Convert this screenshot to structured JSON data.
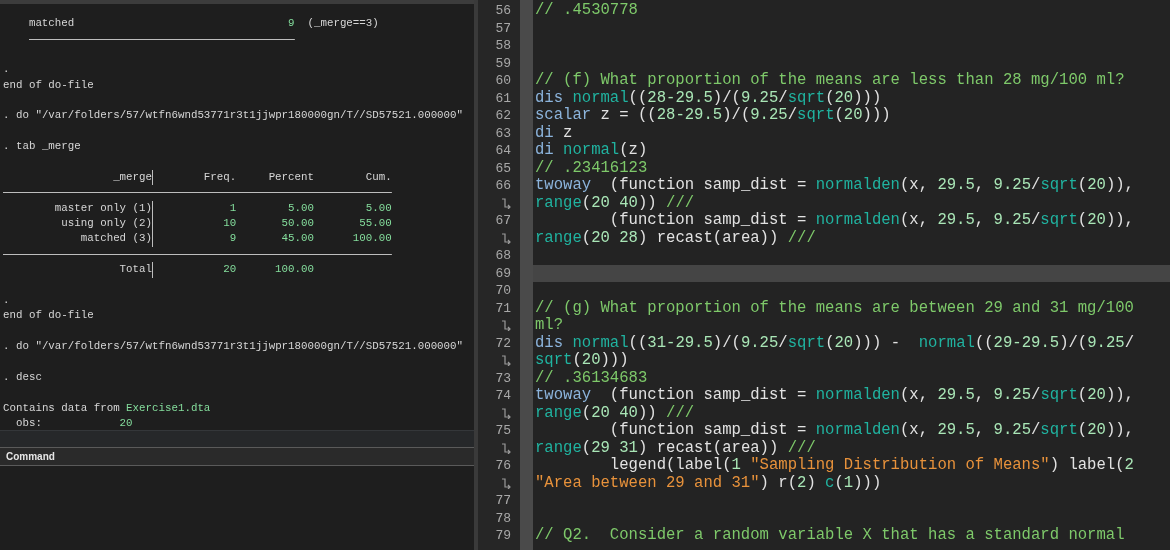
{
  "results": {
    "items": [
      {
        "kind": "summary",
        "label": "matched",
        "value": "9",
        "note": "(_merge==3)"
      },
      {
        "kind": "spacer"
      },
      {
        "kind": "text",
        "text": "."
      },
      {
        "kind": "text",
        "text": "end of do-file"
      },
      {
        "kind": "spacer"
      },
      {
        "kind": "text",
        "text": ". do \"/var/folders/57/wtfn6wnd53771r3t1jjwpr180000gn/T//SD57521.000000\""
      },
      {
        "kind": "spacer"
      },
      {
        "kind": "text",
        "text": ". tab _merge"
      },
      {
        "kind": "spacer"
      },
      {
        "kind": "table",
        "columns": [
          "_merge",
          "Freq.",
          "Percent",
          "Cum."
        ],
        "rows": [
          {
            "cells": [
              "master only (1)",
              "1",
              "5.00",
              "5.00"
            ]
          },
          {
            "cells": [
              "using only (2)",
              "10",
              "50.00",
              "55.00"
            ]
          },
          {
            "cells": [
              "matched (3)",
              "9",
              "45.00",
              "100.00"
            ]
          }
        ],
        "total": {
          "cells": [
            "Total",
            "20",
            "100.00"
          ]
        }
      },
      {
        "kind": "spacer"
      },
      {
        "kind": "text",
        "text": "."
      },
      {
        "kind": "text",
        "text": "end of do-file"
      },
      {
        "kind": "spacer"
      },
      {
        "kind": "text",
        "text": ". do \"/var/folders/57/wtfn6wnd53771r3t1jjwpr180000gn/T//SD57521.000000\""
      },
      {
        "kind": "spacer"
      },
      {
        "kind": "text",
        "text": ". desc"
      },
      {
        "kind": "spacer"
      },
      {
        "kind": "source",
        "text": "Contains data from",
        "file": "Exercise1.dta"
      },
      {
        "kind": "field",
        "label": "obs:",
        "value": "20"
      }
    ]
  },
  "command": {
    "title": "Command"
  },
  "editor": {
    "lines": [
      {
        "number": "56",
        "current": false,
        "segments": [
          [
            {
              "kind": "comment",
              "text": "// .4530778"
            }
          ]
        ]
      },
      {
        "number": "57",
        "current": false
      },
      {
        "number": "58",
        "current": false
      },
      {
        "number": "59",
        "current": false
      },
      {
        "number": "60",
        "current": false,
        "segments": [
          [
            {
              "kind": "comment",
              "text": "// (f) What proportion of the means are less than 28 mg/100 ml?"
            }
          ]
        ]
      },
      {
        "number": "61",
        "current": false,
        "segments": [
          [
            {
              "kind": "keyword",
              "text": "dis "
            },
            {
              "kind": "function",
              "text": "normal"
            },
            {
              "kind": "plain",
              "text": "(("
            },
            {
              "kind": "number",
              "text": "28-29.5"
            },
            {
              "kind": "plain",
              "text": ")/("
            },
            {
              "kind": "number",
              "text": "9.25"
            },
            {
              "kind": "plain",
              "text": "/"
            },
            {
              "kind": "function",
              "text": "sqrt"
            },
            {
              "kind": "plain",
              "text": "("
            },
            {
              "kind": "number",
              "text": "20"
            },
            {
              "kind": "plain",
              "text": ")))"
            }
          ]
        ]
      },
      {
        "number": "62",
        "current": false,
        "segments": [
          [
            {
              "kind": "keyword",
              "text": "scalar"
            },
            {
              "kind": "plain",
              "text": " z = (("
            },
            {
              "kind": "number",
              "text": "28-29.5"
            },
            {
              "kind": "plain",
              "text": ")/("
            },
            {
              "kind": "number",
              "text": "9.25"
            },
            {
              "kind": "plain",
              "text": "/"
            },
            {
              "kind": "function",
              "text": "sqrt"
            },
            {
              "kind": "plain",
              "text": "("
            },
            {
              "kind": "number",
              "text": "20"
            },
            {
              "kind": "plain",
              "text": ")))"
            }
          ]
        ]
      },
      {
        "number": "63",
        "current": false,
        "segments": [
          [
            {
              "kind": "keyword",
              "text": "di"
            },
            {
              "kind": "plain",
              "text": " z"
            }
          ]
        ]
      },
      {
        "number": "64",
        "current": false,
        "segments": [
          [
            {
              "kind": "keyword",
              "text": "di "
            },
            {
              "kind": "function",
              "text": "normal"
            },
            {
              "kind": "plain",
              "text": "(z)"
            }
          ]
        ]
      },
      {
        "number": "65",
        "current": false,
        "segments": [
          [
            {
              "kind": "comment",
              "text": "// .23416123"
            }
          ]
        ]
      },
      {
        "number": "66",
        "current": false,
        "segments": [
          [
            {
              "kind": "keyword",
              "text": "twoway"
            },
            {
              "kind": "plain",
              "text": "  (function samp_dist = "
            },
            {
              "kind": "function",
              "text": "normalden"
            },
            {
              "kind": "plain",
              "text": "(x, "
            },
            {
              "kind": "number",
              "text": "29.5"
            },
            {
              "kind": "plain",
              "text": ", "
            },
            {
              "kind": "number",
              "text": "9.25"
            },
            {
              "kind": "plain",
              "text": "/"
            },
            {
              "kind": "function",
              "text": "sqrt"
            },
            {
              "kind": "plain",
              "text": "("
            },
            {
              "kind": "number",
              "text": "20"
            },
            {
              "kind": "plain",
              "text": ")),"
            }
          ],
          [
            {
              "kind": "function",
              "text": "range"
            },
            {
              "kind": "plain",
              "text": "("
            },
            {
              "kind": "number",
              "text": "20 40"
            },
            {
              "kind": "plain",
              "text": ")) "
            },
            {
              "kind": "comment",
              "text": "///"
            }
          ]
        ]
      },
      {
        "number": "67",
        "current": false,
        "segments": [
          [
            {
              "kind": "plain",
              "text": "        (function samp_dist = "
            },
            {
              "kind": "function",
              "text": "normalden"
            },
            {
              "kind": "plain",
              "text": "(x, "
            },
            {
              "kind": "number",
              "text": "29.5"
            },
            {
              "kind": "plain",
              "text": ", "
            },
            {
              "kind": "number",
              "text": "9.25"
            },
            {
              "kind": "plain",
              "text": "/"
            },
            {
              "kind": "function",
              "text": "sqrt"
            },
            {
              "kind": "plain",
              "text": "("
            },
            {
              "kind": "number",
              "text": "20"
            },
            {
              "kind": "plain",
              "text": ")),"
            }
          ],
          [
            {
              "kind": "function",
              "text": "range"
            },
            {
              "kind": "plain",
              "text": "("
            },
            {
              "kind": "number",
              "text": "20 28"
            },
            {
              "kind": "plain",
              "text": ") recast(area)) "
            },
            {
              "kind": "comment",
              "text": "///"
            }
          ]
        ]
      },
      {
        "number": "68",
        "current": false
      },
      {
        "number": "69",
        "current": true
      },
      {
        "number": "70",
        "current": false
      },
      {
        "number": "71",
        "current": false,
        "segments": [
          [
            {
              "kind": "comment",
              "text": "// (g) What proportion of the means are between 29 and 31 mg/100"
            }
          ],
          [
            {
              "kind": "comment",
              "text": "ml?"
            }
          ]
        ]
      },
      {
        "number": "72",
        "current": false,
        "segments": [
          [
            {
              "kind": "keyword",
              "text": "dis "
            },
            {
              "kind": "function",
              "text": "normal"
            },
            {
              "kind": "plain",
              "text": "(("
            },
            {
              "kind": "number",
              "text": "31-29.5"
            },
            {
              "kind": "plain",
              "text": ")/("
            },
            {
              "kind": "number",
              "text": "9.25"
            },
            {
              "kind": "plain",
              "text": "/"
            },
            {
              "kind": "function",
              "text": "sqrt"
            },
            {
              "kind": "plain",
              "text": "("
            },
            {
              "kind": "number",
              "text": "20"
            },
            {
              "kind": "plain",
              "text": "))) -  "
            },
            {
              "kind": "function",
              "text": "normal"
            },
            {
              "kind": "plain",
              "text": "(("
            },
            {
              "kind": "number",
              "text": "29-29.5"
            },
            {
              "kind": "plain",
              "text": ")/("
            },
            {
              "kind": "number",
              "text": "9.25"
            },
            {
              "kind": "plain",
              "text": "/"
            }
          ],
          [
            {
              "kind": "function",
              "text": "sqrt"
            },
            {
              "kind": "plain",
              "text": "("
            },
            {
              "kind": "number",
              "text": "20"
            },
            {
              "kind": "plain",
              "text": ")))"
            }
          ]
        ]
      },
      {
        "number": "73",
        "current": false,
        "segments": [
          [
            {
              "kind": "comment",
              "text": "// .36134683"
            }
          ]
        ]
      },
      {
        "number": "74",
        "current": false,
        "segments": [
          [
            {
              "kind": "keyword",
              "text": "twoway"
            },
            {
              "kind": "plain",
              "text": "  (function samp_dist = "
            },
            {
              "kind": "function",
              "text": "normalden"
            },
            {
              "kind": "plain",
              "text": "(x, "
            },
            {
              "kind": "number",
              "text": "29.5"
            },
            {
              "kind": "plain",
              "text": ", "
            },
            {
              "kind": "number",
              "text": "9.25"
            },
            {
              "kind": "plain",
              "text": "/"
            },
            {
              "kind": "function",
              "text": "sqrt"
            },
            {
              "kind": "plain",
              "text": "("
            },
            {
              "kind": "number",
              "text": "20"
            },
            {
              "kind": "plain",
              "text": ")),"
            }
          ],
          [
            {
              "kind": "function",
              "text": "range"
            },
            {
              "kind": "plain",
              "text": "("
            },
            {
              "kind": "number",
              "text": "20 40"
            },
            {
              "kind": "plain",
              "text": ")) "
            },
            {
              "kind": "comment",
              "text": "///"
            }
          ]
        ]
      },
      {
        "number": "75",
        "current": false,
        "segments": [
          [
            {
              "kind": "plain",
              "text": "        (function samp_dist = "
            },
            {
              "kind": "function",
              "text": "normalden"
            },
            {
              "kind": "plain",
              "text": "(x, "
            },
            {
              "kind": "number",
              "text": "29.5"
            },
            {
              "kind": "plain",
              "text": ", "
            },
            {
              "kind": "number",
              "text": "9.25"
            },
            {
              "kind": "plain",
              "text": "/"
            },
            {
              "kind": "function",
              "text": "sqrt"
            },
            {
              "kind": "plain",
              "text": "("
            },
            {
              "kind": "number",
              "text": "20"
            },
            {
              "kind": "plain",
              "text": ")),"
            }
          ],
          [
            {
              "kind": "function",
              "text": "range"
            },
            {
              "kind": "plain",
              "text": "("
            },
            {
              "kind": "number",
              "text": "29 31"
            },
            {
              "kind": "plain",
              "text": ") recast(area)) "
            },
            {
              "kind": "comment",
              "text": "///"
            }
          ]
        ]
      },
      {
        "number": "76",
        "current": false,
        "segments": [
          [
            {
              "kind": "plain",
              "text": "        legend(label("
            },
            {
              "kind": "number",
              "text": "1 "
            },
            {
              "kind": "string",
              "text": "\"Sampling Distribution of Means\""
            },
            {
              "kind": "plain",
              "text": ") label("
            },
            {
              "kind": "number",
              "text": "2"
            }
          ],
          [
            {
              "kind": "string",
              "text": "\"Area between 29 and 31\""
            },
            {
              "kind": "plain",
              "text": ") r("
            },
            {
              "kind": "number",
              "text": "2"
            },
            {
              "kind": "plain",
              "text": ") "
            },
            {
              "kind": "function",
              "text": "c"
            },
            {
              "kind": "plain",
              "text": "("
            },
            {
              "kind": "number",
              "text": "1"
            },
            {
              "kind": "plain",
              "text": ")))"
            }
          ]
        ]
      },
      {
        "number": "77",
        "current": false
      },
      {
        "number": "78",
        "current": false
      },
      {
        "number": "79",
        "current": false,
        "segments": [
          [
            {
              "kind": "comment",
              "text": "// Q2.  Consider a random variable X that has a standard normal"
            }
          ]
        ]
      }
    ]
  }
}
